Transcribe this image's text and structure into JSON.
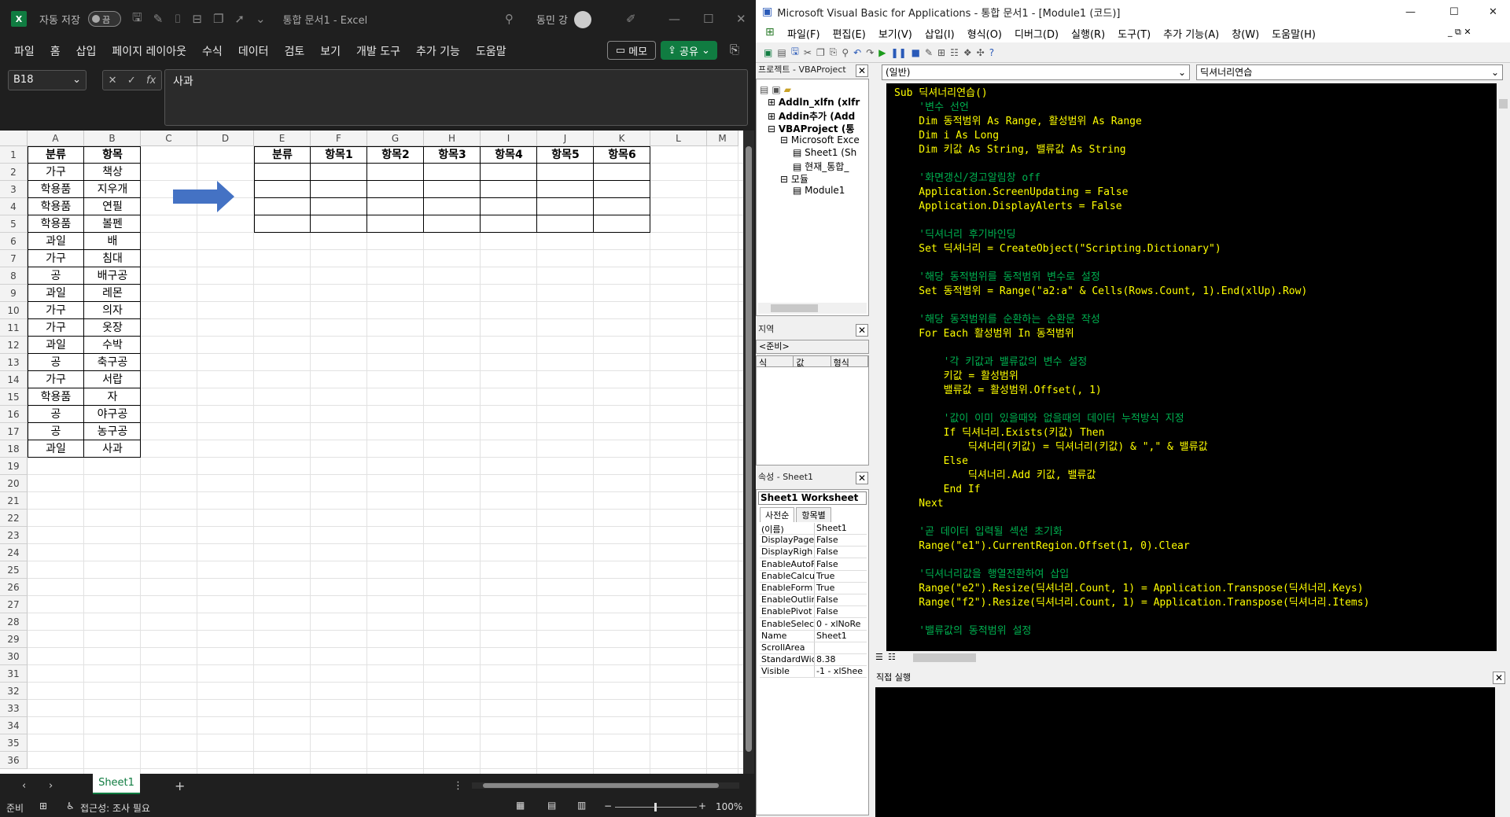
{
  "excel": {
    "autosave_label": "자동 저장",
    "autosave_state": "끔",
    "title": "통합 문서1 - Excel",
    "user": "동민 강",
    "menu": [
      "파일",
      "홈",
      "삽입",
      "페이지 레이아웃",
      "수식",
      "데이터",
      "검토",
      "보기",
      "개발 도구",
      "추가 기능",
      "도움말"
    ],
    "memo_label": "메모",
    "share_label": "공유",
    "name_box": "B18",
    "formula": "사과",
    "columns": [
      "A",
      "B",
      "C",
      "D",
      "E",
      "F",
      "G",
      "H",
      "I",
      "J",
      "K",
      "L",
      "M"
    ],
    "rows": [
      "1",
      "2",
      "3",
      "4",
      "5",
      "6",
      "7",
      "8",
      "9",
      "10",
      "11",
      "12",
      "13",
      "14",
      "15",
      "16",
      "17",
      "18",
      "19",
      "20",
      "21",
      "22",
      "23",
      "24",
      "25",
      "26",
      "27",
      "28",
      "29",
      "30",
      "31",
      "32",
      "33",
      "34",
      "35",
      "36"
    ],
    "table_a_header": [
      "분류",
      "항목"
    ],
    "table_a": [
      [
        "가구",
        "책상"
      ],
      [
        "학용품",
        "지우개"
      ],
      [
        "학용품",
        "연필"
      ],
      [
        "학용품",
        "볼펜"
      ],
      [
        "과일",
        "배"
      ],
      [
        "가구",
        "침대"
      ],
      [
        "공",
        "배구공"
      ],
      [
        "과일",
        "레몬"
      ],
      [
        "가구",
        "의자"
      ],
      [
        "가구",
        "옷장"
      ],
      [
        "과일",
        "수박"
      ],
      [
        "공",
        "축구공"
      ],
      [
        "가구",
        "서랍"
      ],
      [
        "학용품",
        "자"
      ],
      [
        "공",
        "야구공"
      ],
      [
        "공",
        "농구공"
      ],
      [
        "과일",
        "사과"
      ]
    ],
    "table_b_header": [
      "분류",
      "항목1",
      "항목2",
      "항목3",
      "항목4",
      "항목5",
      "항목6"
    ],
    "sheet_tab": "Sheet1",
    "status_ready": "준비",
    "status_accessibility": "접근성: 조사 필요",
    "zoom": "100%",
    "colors": {
      "accent": "#107c41",
      "arrow": "#4472c4"
    }
  },
  "vbe": {
    "title": "Microsoft Visual Basic for Applications - 통합 문서1 - [Module1 (코드)]",
    "menu": [
      "파일(F)",
      "편집(E)",
      "보기(V)",
      "삽입(I)",
      "형식(O)",
      "디버그(D)",
      "실행(R)",
      "도구(T)",
      "추가 기능(A)",
      "창(W)",
      "도움말(H)"
    ],
    "project_title": "프로젝트 - VBAProject",
    "tree": [
      {
        "label": "Addln_xlfn (xlfr",
        "bold": true
      },
      {
        "label": "Addin추가 (Add",
        "bold": true
      },
      {
        "label": "VBAProject (통",
        "bold": true
      },
      {
        "label": "Microsoft Exce",
        "bold": false
      },
      {
        "label": "Sheet1 (Sh",
        "bold": false
      },
      {
        "label": "현재_통합_",
        "bold": false
      },
      {
        "label": "모듈",
        "bold": false
      },
      {
        "label": "Module1",
        "bold": false
      }
    ],
    "locals_title": "지역",
    "locals_ready": "<준비>",
    "locals_cols": [
      "식",
      "값",
      "형식"
    ],
    "props_title": "속성 - Sheet1",
    "props_object": "Sheet1 Worksheet",
    "props_tabs": [
      "사전순",
      "항목별"
    ],
    "props": [
      [
        "(이름)",
        "Sheet1"
      ],
      [
        "DisplayPage",
        "False"
      ],
      [
        "DisplayRigh",
        "False"
      ],
      [
        "EnableAutoF",
        "False"
      ],
      [
        "EnableCalcu",
        "True"
      ],
      [
        "EnableForm",
        "True"
      ],
      [
        "EnableOutlin",
        "False"
      ],
      [
        "EnablePivot",
        "False"
      ],
      [
        "EnableSelec",
        "0 - xlNoRe"
      ],
      [
        "Name",
        "Sheet1"
      ],
      [
        "ScrollArea",
        ""
      ],
      [
        "StandardWid",
        "8.38"
      ],
      [
        "Visible",
        "-1 - xlShee"
      ]
    ],
    "combo_left": "(일반)",
    "combo_right": "딕셔너리연습",
    "immediate_title": "직접 실행",
    "code": [
      {
        "t": "Sub 딕셔너리연습()",
        "c": "kw"
      },
      {
        "t": "    '변수 선언",
        "c": "cm"
      },
      {
        "t": "    Dim 동적범위 As Range, 활성범위 As Range",
        "c": "kw"
      },
      {
        "t": "    Dim i As Long",
        "c": "kw"
      },
      {
        "t": "    Dim 키값 As String, 밸류값 As String",
        "c": "kw"
      },
      {
        "t": "",
        "c": "tx"
      },
      {
        "t": "    '화면갱신/경고알림창 off",
        "c": "cm"
      },
      {
        "t": "    Application.ScreenUpdating = False",
        "c": "tx"
      },
      {
        "t": "    Application.DisplayAlerts = False",
        "c": "tx"
      },
      {
        "t": "",
        "c": "tx"
      },
      {
        "t": "    '딕셔너리 후기바인딩",
        "c": "cm"
      },
      {
        "t": "    Set 딕셔너리 = CreateObject(\"Scripting.Dictionary\")",
        "c": "tx"
      },
      {
        "t": "",
        "c": "tx"
      },
      {
        "t": "    '해당 동적범위를 동적범위 변수로 설정",
        "c": "cm"
      },
      {
        "t": "    Set 동적범위 = Range(\"a2:a\" & Cells(Rows.Count, 1).End(xlUp).Row)",
        "c": "tx"
      },
      {
        "t": "",
        "c": "tx"
      },
      {
        "t": "    '해당 동적범위를 순환하는 순환문 작성",
        "c": "cm"
      },
      {
        "t": "    For Each 활성범위 In 동적범위",
        "c": "kw"
      },
      {
        "t": "",
        "c": "tx"
      },
      {
        "t": "        '각 키값과 밸류값의 변수 설정",
        "c": "cm"
      },
      {
        "t": "        키값 = 활성범위",
        "c": "tx"
      },
      {
        "t": "        밸류값 = 활성범위.Offset(, 1)",
        "c": "tx"
      },
      {
        "t": "",
        "c": "tx"
      },
      {
        "t": "        '값이 이미 있을때와 없을때의 데이터 누적방식 지정",
        "c": "cm"
      },
      {
        "t": "        If 딕셔너리.Exists(키값) Then",
        "c": "kw"
      },
      {
        "t": "            딕셔너리(키값) = 딕셔너리(키값) & \",\" & 밸류값",
        "c": "tx"
      },
      {
        "t": "        Else",
        "c": "kw"
      },
      {
        "t": "            딕셔너리.Add 키값, 밸류값",
        "c": "tx"
      },
      {
        "t": "        End If",
        "c": "kw"
      },
      {
        "t": "    Next",
        "c": "kw"
      },
      {
        "t": "",
        "c": "tx"
      },
      {
        "t": "    '곧 데이터 입력될 섹션 초기화",
        "c": "cm"
      },
      {
        "t": "    Range(\"e1\").CurrentRegion.Offset(1, 0).Clear",
        "c": "tx"
      },
      {
        "t": "",
        "c": "tx"
      },
      {
        "t": "    '딕셔너리값을 행열전환하여 삽입",
        "c": "cm"
      },
      {
        "t": "    Range(\"e2\").Resize(딕셔너리.Count, 1) = Application.Transpose(딕셔너리.Keys)",
        "c": "tx"
      },
      {
        "t": "    Range(\"f2\").Resize(딕셔너리.Count, 1) = Application.Transpose(딕셔너리.Items)",
        "c": "tx"
      },
      {
        "t": "",
        "c": "tx"
      },
      {
        "t": "    '밸류값의 동적범위 설정",
        "c": "cm"
      }
    ]
  }
}
